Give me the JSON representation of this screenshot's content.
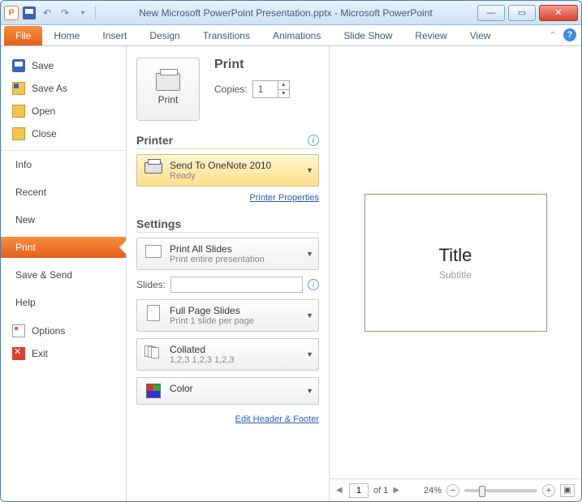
{
  "titlebar": {
    "app_letter": "P",
    "title": "New Microsoft PowerPoint Presentation.pptx - Microsoft PowerPoint"
  },
  "ribbon": {
    "tabs": [
      "File",
      "Home",
      "Insert",
      "Design",
      "Transitions",
      "Animations",
      "Slide Show",
      "Review",
      "View"
    ]
  },
  "sidebar": {
    "items_top": [
      {
        "label": "Save",
        "icon": "save"
      },
      {
        "label": "Save As",
        "icon": "saveas"
      },
      {
        "label": "Open",
        "icon": "open"
      },
      {
        "label": "Close",
        "icon": "close"
      }
    ],
    "items_mid": [
      "Info",
      "Recent",
      "New",
      "Print",
      "Save & Send",
      "Help"
    ],
    "items_bottom": [
      {
        "label": "Options",
        "icon": "options"
      },
      {
        "label": "Exit",
        "icon": "exit"
      }
    ],
    "active": "Print"
  },
  "print_panel": {
    "print_heading": "Print",
    "print_button": "Print",
    "copies_label": "Copies:",
    "copies_value": "1",
    "printer_heading": "Printer",
    "printer_name": "Send To OneNote 2010",
    "printer_status": "Ready",
    "printer_properties": "Printer Properties",
    "settings_heading": "Settings",
    "setting_all_slides": {
      "title": "Print All Slides",
      "sub": "Print entire presentation"
    },
    "slides_label": "Slides:",
    "setting_full_page": {
      "title": "Full Page Slides",
      "sub": "Print 1 slide per page"
    },
    "setting_collated": {
      "title": "Collated",
      "sub": "1,2,3   1,2,3   1,2,3"
    },
    "setting_color": {
      "title": "Color"
    },
    "edit_header_footer": "Edit Header & Footer"
  },
  "preview": {
    "slide_title": "Title",
    "slide_subtitle": "Subtitle",
    "page_current": "1",
    "page_of": "of 1",
    "zoom": "24%"
  }
}
